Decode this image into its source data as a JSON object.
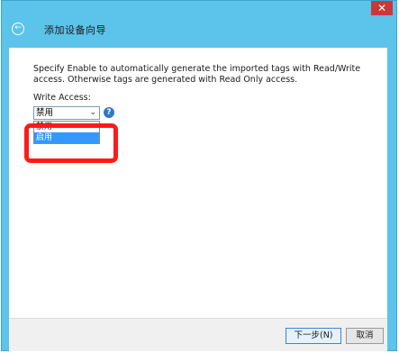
{
  "window": {
    "title": "添加设备向导"
  },
  "description": "Specify Enable to automatically generate the imported tags with Read/Write access. Otherwise tags are generated with Read Only access.",
  "field": {
    "label": "Write Access:",
    "selected": "禁用",
    "options": [
      "禁用",
      "启用"
    ]
  },
  "buttons": {
    "next": "下一步(N)",
    "cancel": "取消"
  },
  "colors": {
    "accent": "#5cc3ea",
    "highlight": "#ff1a1a",
    "selection": "#3399ff"
  },
  "icons": {
    "back": "back-arrow-icon",
    "help": "help-icon",
    "dropdown": "chevron-down-icon",
    "close": "close-icon"
  }
}
